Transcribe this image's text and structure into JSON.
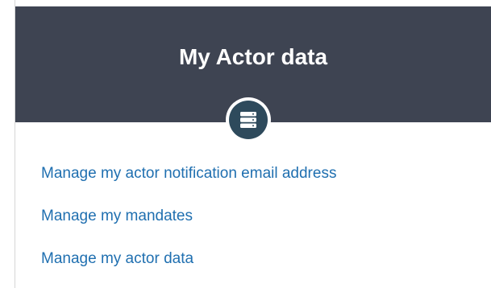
{
  "card": {
    "title": "My Actor data",
    "icon": "server-database-icon",
    "links": [
      {
        "label": "Manage my actor notification email address"
      },
      {
        "label": "Manage my mandates"
      },
      {
        "label": "Manage my actor data"
      }
    ]
  },
  "colors": {
    "header_background": "#3e4452",
    "icon_circle": "#2e4a5c",
    "link": "#1f6fb0"
  }
}
